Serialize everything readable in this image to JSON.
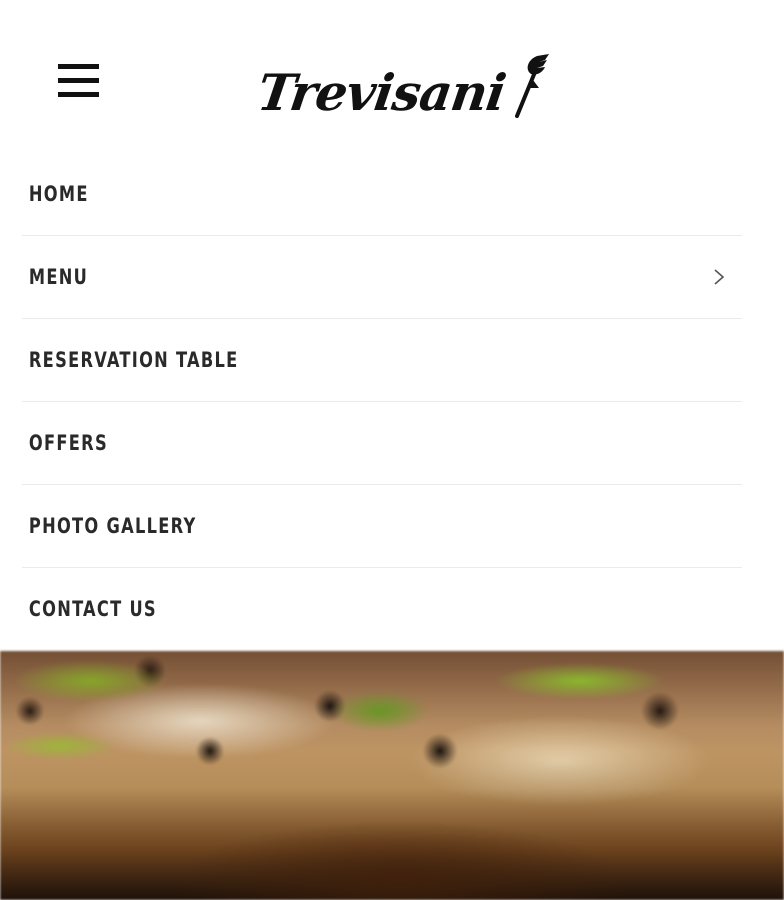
{
  "header": {
    "logo_text": "Trevisani",
    "logo_icon": "fork-icon",
    "menu_toggle_icon": "hamburger-icon"
  },
  "menu": {
    "items": [
      {
        "label": "HOME",
        "has_submenu": false
      },
      {
        "label": "MENU",
        "has_submenu": true
      },
      {
        "label": "RESERVATION TABLE",
        "has_submenu": false
      },
      {
        "label": "OFFERS",
        "has_submenu": false
      },
      {
        "label": "PHOTO GALLERY",
        "has_submenu": false
      },
      {
        "label": "CONTACT US",
        "has_submenu": false
      }
    ]
  },
  "hero": {
    "image": "pizza-photo"
  },
  "colors": {
    "text": "#2a2a2a",
    "divider": "#ebebeb",
    "background": "#ffffff"
  }
}
